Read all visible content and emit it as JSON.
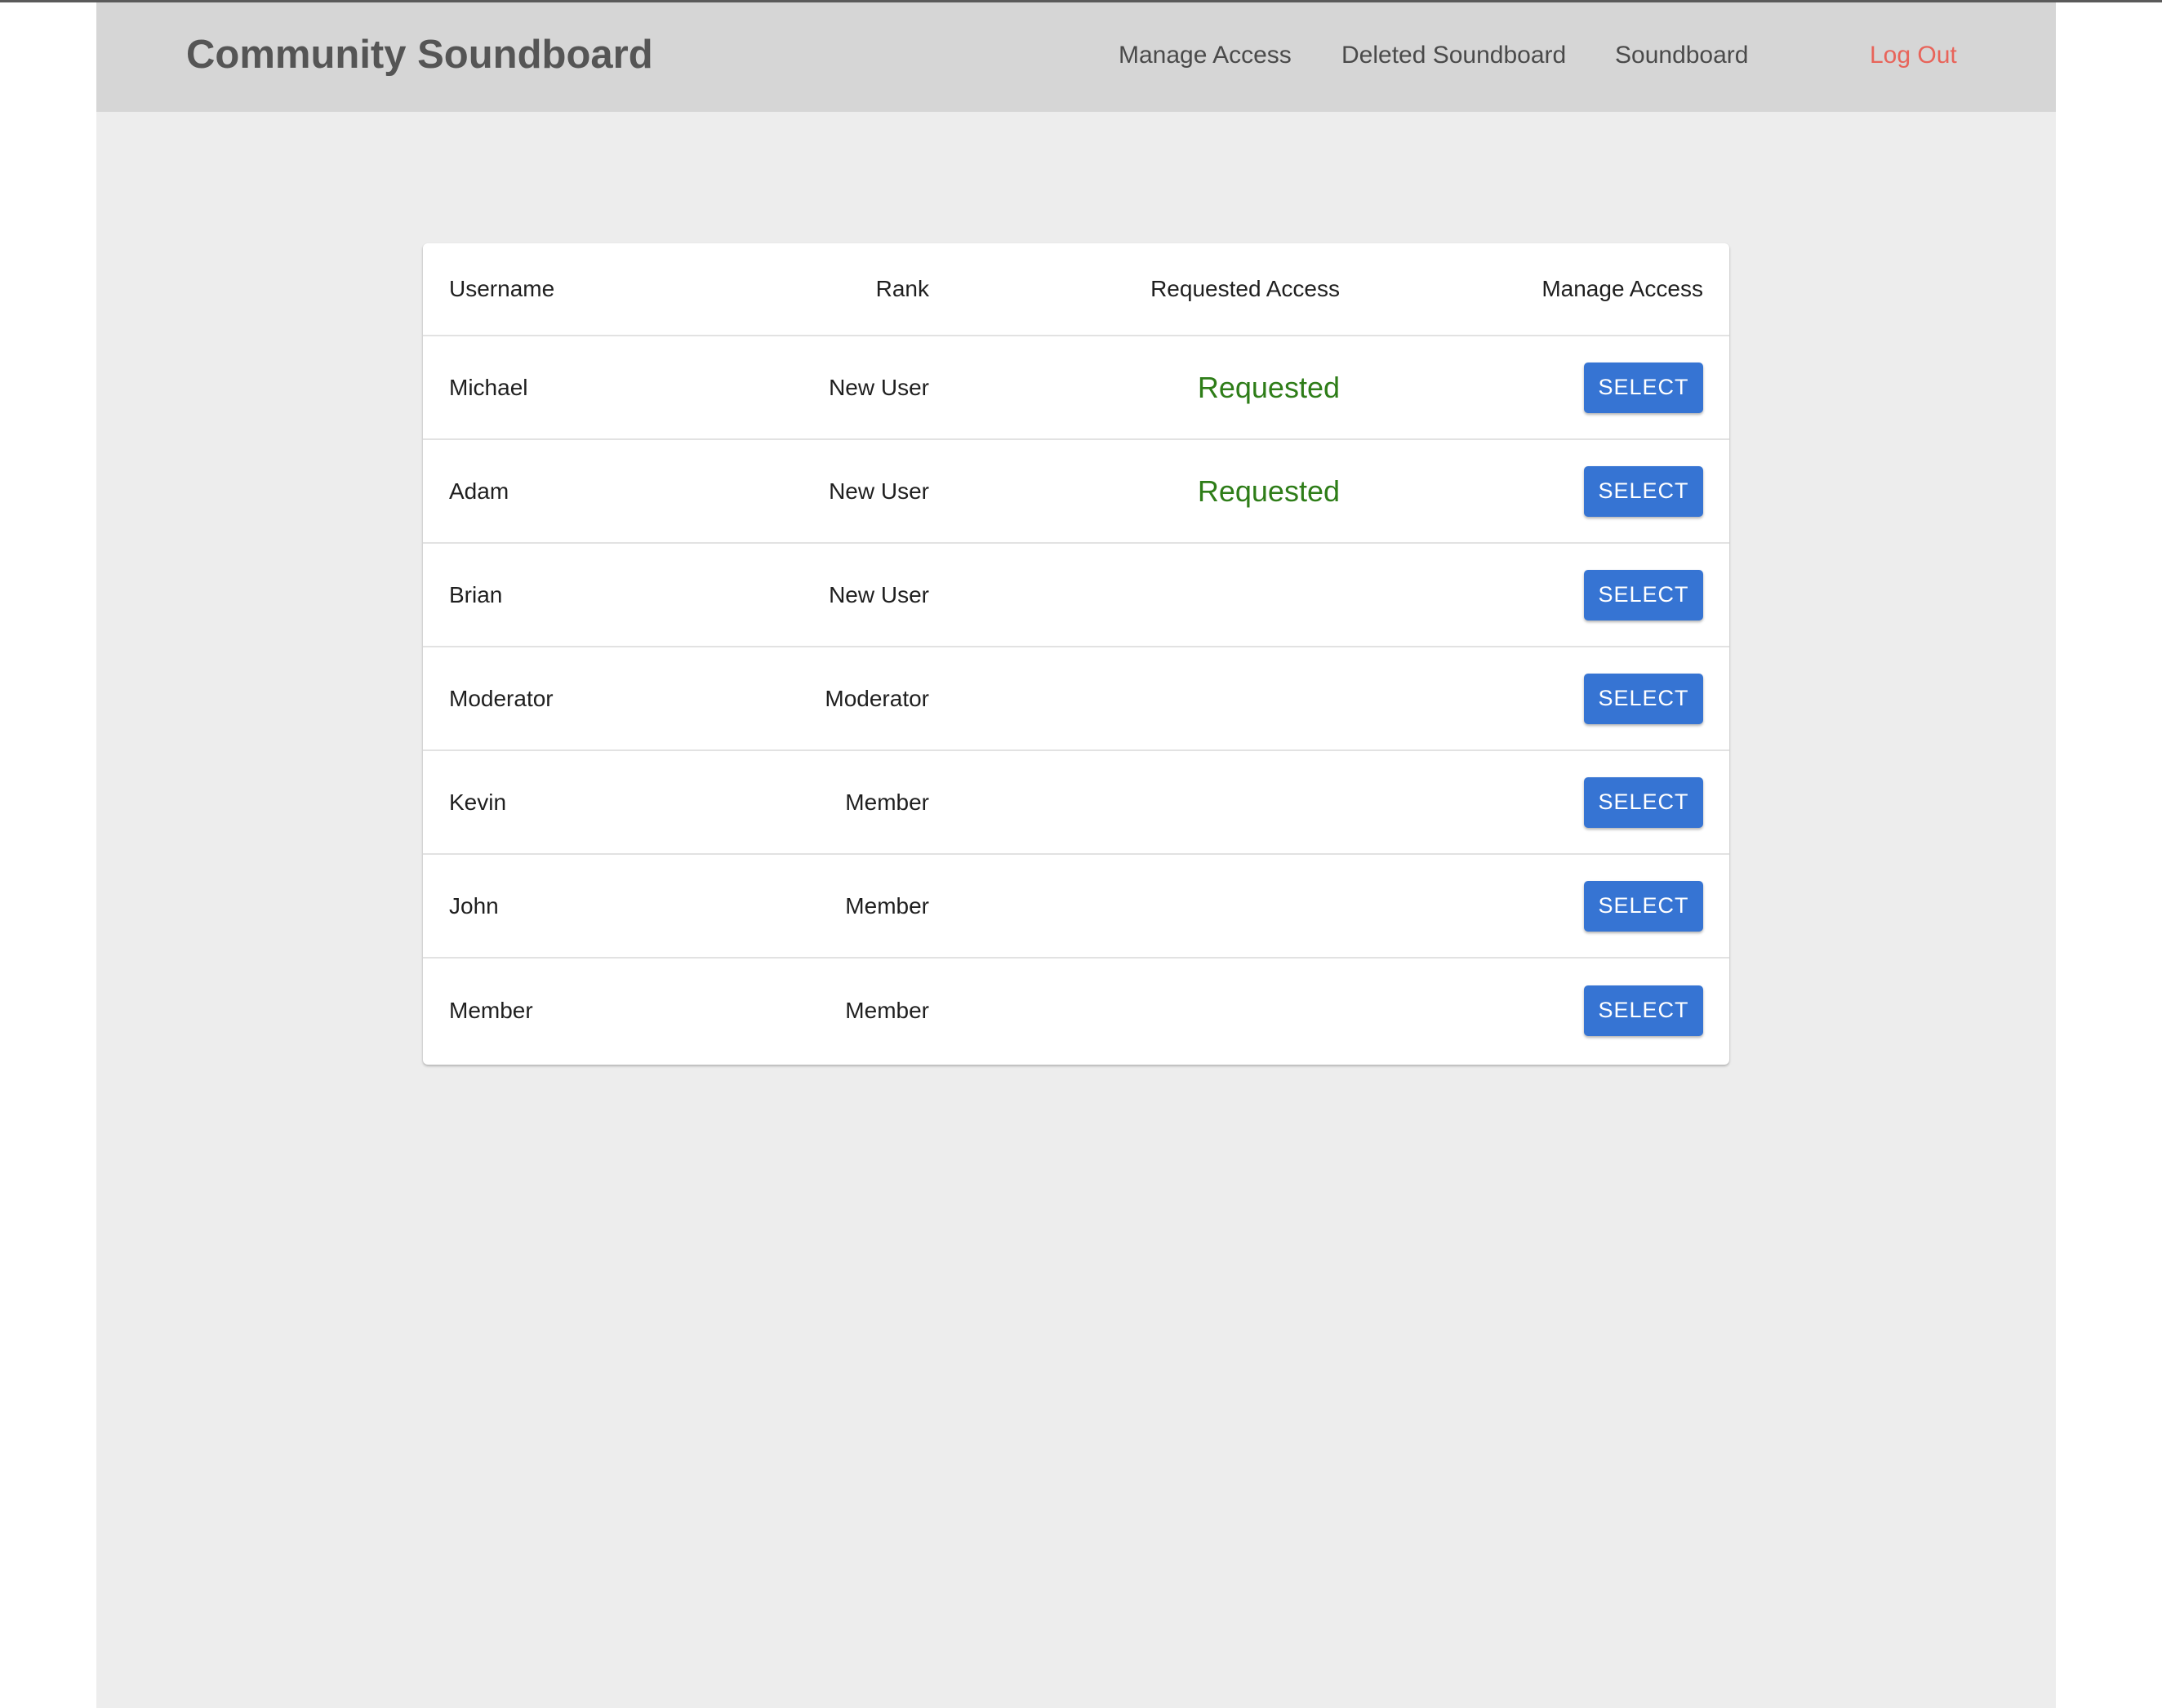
{
  "nav": {
    "brand": "Community Soundboard",
    "links": {
      "manage_access": "Manage Access",
      "deleted_soundboard": "Deleted Soundboard",
      "soundboard": "Soundboard",
      "log_out": "Log Out"
    }
  },
  "table": {
    "columns": {
      "username": "Username",
      "rank": "Rank",
      "requested_access": "Requested Access",
      "manage_access": "Manage Access"
    },
    "rows": [
      {
        "username": "Michael",
        "rank": "New User",
        "requested": "Requested",
        "action": "SELECT"
      },
      {
        "username": "Adam",
        "rank": "New User",
        "requested": "Requested",
        "action": "SELECT"
      },
      {
        "username": "Brian",
        "rank": "New User",
        "requested": "",
        "action": "SELECT"
      },
      {
        "username": "Moderator",
        "rank": "Moderator",
        "requested": "",
        "action": "SELECT"
      },
      {
        "username": "Kevin",
        "rank": "Member",
        "requested": "",
        "action": "SELECT"
      },
      {
        "username": "John",
        "rank": "Member",
        "requested": "",
        "action": "SELECT"
      },
      {
        "username": "Member",
        "rank": "Member",
        "requested": "",
        "action": "SELECT"
      }
    ]
  },
  "colors": {
    "navbar_bg": "#d6d6d6",
    "page_bg": "#ededed",
    "accent_button": "#3674d3",
    "requested_text": "#2e7d18",
    "logout_text": "#e8645a"
  }
}
